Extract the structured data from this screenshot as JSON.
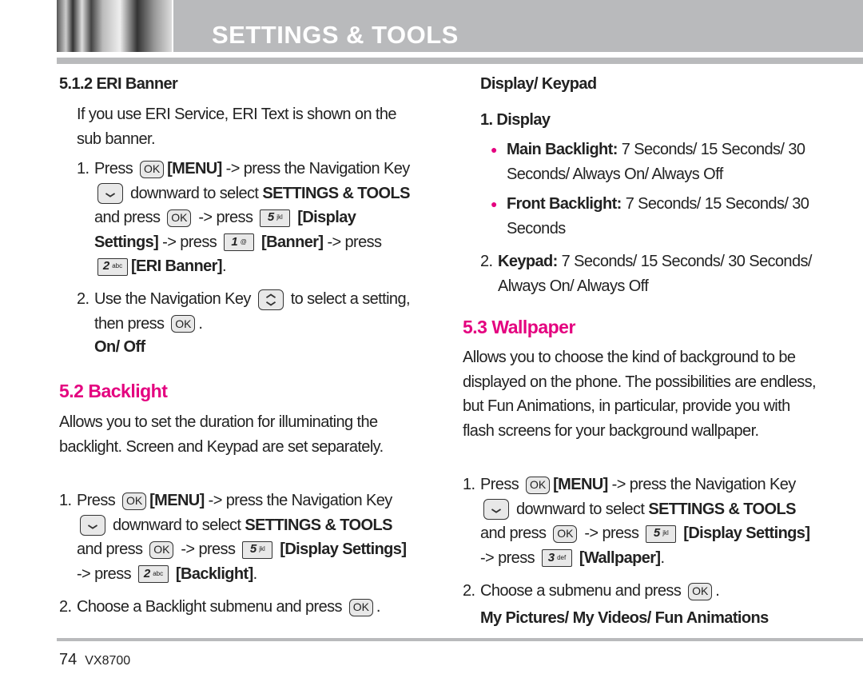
{
  "header": {
    "title": "SETTINGS & TOOLS"
  },
  "keys": {
    "ok": {
      "label": "OK"
    },
    "k1": {
      "digit": "1",
      "letters": "@"
    },
    "k2": {
      "digit": "2",
      "letters": "abc"
    },
    "k3": {
      "digit": "3",
      "letters": "def"
    },
    "k5": {
      "digit": "5",
      "letters": "jkl"
    }
  },
  "left": [
    {
      "type": "h",
      "runs": [
        {
          "t": "5.1.2 ERI Banner"
        }
      ]
    },
    {
      "type": "p",
      "indent": 22,
      "runs": [
        {
          "t": "If you use ERI Service, ERI Text is shown on the sub banner."
        }
      ]
    },
    {
      "type": "li",
      "indent": 22,
      "n": "1.",
      "runs": [
        {
          "t": "Press "
        },
        {
          "k": "ok"
        },
        {
          "t": "[MENU]",
          "b": 1
        },
        {
          "t": " -> press the Navigation Key "
        },
        {
          "k": "down"
        },
        {
          "t": " downward to select "
        },
        {
          "t": "SETTINGS & TOOLS",
          "b": 1
        },
        {
          "t": " and press "
        },
        {
          "k": "ok"
        },
        {
          "t": " -> press "
        },
        {
          "k": "k5"
        },
        {
          "t": " [Display Settings]",
          "b": 1
        },
        {
          "t": " -> press "
        },
        {
          "k": "k1"
        },
        {
          "t": " [Banner]",
          "b": 1
        },
        {
          "t": " -> press "
        },
        {
          "k": "k2"
        },
        {
          "t": "[ERI Banner]",
          "b": 1
        },
        {
          "t": "."
        }
      ]
    },
    {
      "type": "li",
      "indent": 22,
      "n": "2.",
      "runs": [
        {
          "t": "Use the Navigation Key "
        },
        {
          "k": "updown"
        },
        {
          "t": " to select a setting, then press "
        },
        {
          "k": "ok"
        },
        {
          "t": "."
        }
      ]
    },
    {
      "type": "h",
      "indent": 44,
      "runs": [
        {
          "t": "On/ Off"
        }
      ]
    },
    {
      "type": "pink",
      "runs": [
        {
          "t": "5.2 Backlight"
        }
      ]
    },
    {
      "type": "p",
      "runs": [
        {
          "t": "Allows you to set the duration for illuminating the backlight. Screen and Keypad are set separately."
        }
      ]
    },
    {
      "type": "li",
      "n": "1.",
      "runs": [
        {
          "t": "Press "
        },
        {
          "k": "ok"
        },
        {
          "t": "[MENU]",
          "b": 1
        },
        {
          "t": " -> press the Navigation Key "
        },
        {
          "k": "down"
        },
        {
          "t": " downward to select "
        },
        {
          "t": "SETTINGS & TOOLS",
          "b": 1
        },
        {
          "t": " and press "
        },
        {
          "k": "ok"
        },
        {
          "t": " -> press "
        },
        {
          "k": "k5"
        },
        {
          "t": " [Display Settings]",
          "b": 1
        },
        {
          "t": " -> press "
        },
        {
          "k": "k2"
        },
        {
          "t": " [Backlight]",
          "b": 1
        },
        {
          "t": "."
        }
      ]
    },
    {
      "type": "li",
      "n": "2.",
      "runs": [
        {
          "t": "Choose a Backlight submenu and press "
        },
        {
          "k": "ok"
        },
        {
          "t": "."
        }
      ]
    }
  ],
  "right": [
    {
      "type": "h",
      "indent": 22,
      "runs": [
        {
          "t": "Display/ Keypad"
        }
      ]
    },
    {
      "type": "h",
      "indent": 22,
      "runs": [
        {
          "t": "1. Display"
        }
      ]
    },
    {
      "type": "bullet",
      "indent": 35,
      "runs": [
        {
          "t": "Main Backlight:",
          "b": 1
        },
        {
          "t": " 7 Seconds/ 15 Seconds/ 30 Seconds/ Always On/ Always Off"
        }
      ]
    },
    {
      "type": "bullet",
      "indent": 35,
      "runs": [
        {
          "t": "Front Backlight:",
          "b": 1
        },
        {
          "t": " 7 Seconds/ 15 Seconds/ 30 Seconds"
        }
      ]
    },
    {
      "type": "li",
      "indent": 22,
      "n": "2.",
      "runs": [
        {
          "t": "Keypad:",
          "b": 1
        },
        {
          "t": " 7 Seconds/ 15 Seconds/ 30 Seconds/ Always On/ Always Off"
        }
      ]
    },
    {
      "type": "pink",
      "runs": [
        {
          "t": "5.3 Wallpaper"
        }
      ]
    },
    {
      "type": "p",
      "runs": [
        {
          "t": "Allows you to choose the kind of background to be displayed on the phone. The possibilities are endless, but Fun Animations, in particular, provide you with flash screens for your background wallpaper."
        }
      ]
    },
    {
      "type": "li",
      "n": "1.",
      "runs": [
        {
          "t": "Press "
        },
        {
          "k": "ok"
        },
        {
          "t": "[MENU]",
          "b": 1
        },
        {
          "t": " -> press the Navigation Key "
        },
        {
          "k": "down"
        },
        {
          "t": " downward to select "
        },
        {
          "t": "SETTINGS & TOOLS",
          "b": 1
        },
        {
          "t": " and press "
        },
        {
          "k": "ok"
        },
        {
          "t": " -> press "
        },
        {
          "k": "k5"
        },
        {
          "t": " [Display Settings]",
          "b": 1
        },
        {
          "t": " -> press "
        },
        {
          "k": "k3"
        },
        {
          "t": " [Wallpaper]",
          "b": 1
        },
        {
          "t": "."
        }
      ]
    },
    {
      "type": "li",
      "n": "2.",
      "runs": [
        {
          "t": "Choose a submenu and press "
        },
        {
          "k": "ok"
        },
        {
          "t": "."
        }
      ]
    },
    {
      "type": "h",
      "indent": 22,
      "runs": [
        {
          "t": "My Pictures/ My Videos/ Fun Animations"
        }
      ]
    }
  ],
  "footer": {
    "page": "74",
    "model": "VX8700"
  }
}
